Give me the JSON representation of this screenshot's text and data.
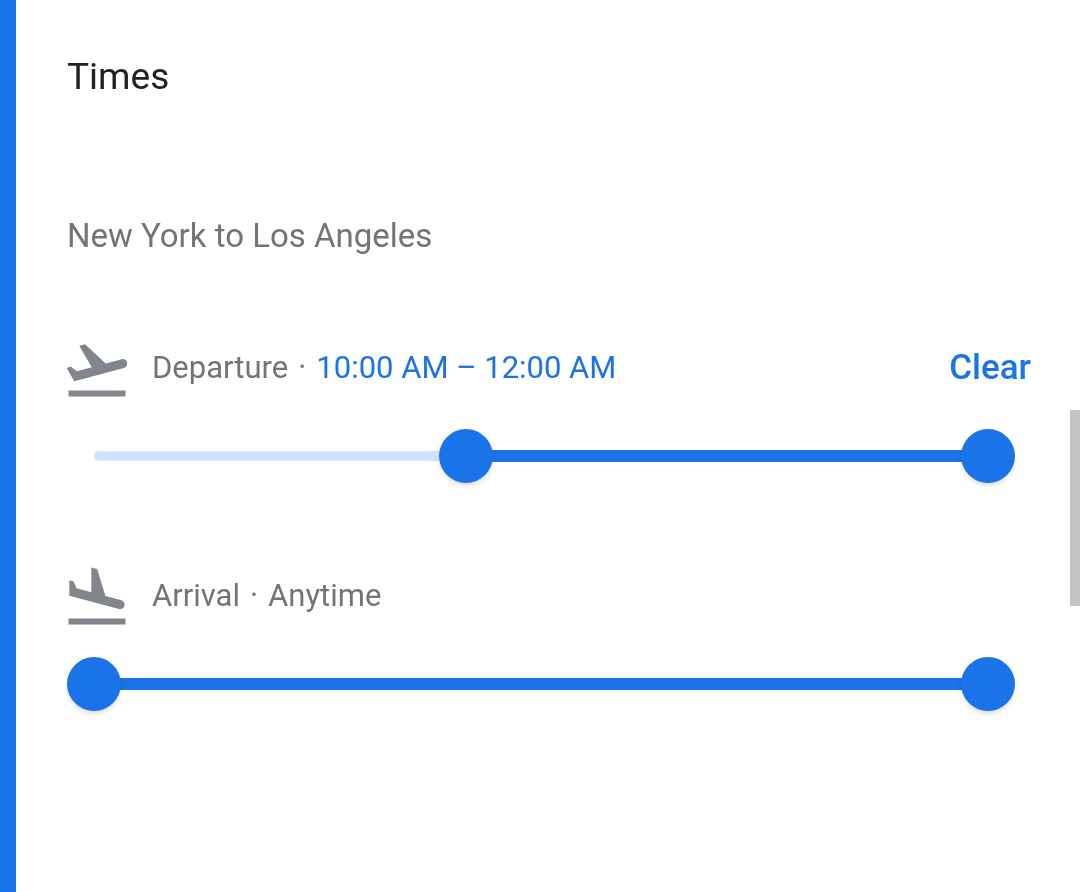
{
  "title": "Times",
  "route": "New York to Los Angeles",
  "filters": [
    {
      "kind": "departure",
      "label": "Departure",
      "separator": "·",
      "value": "10:00 AM – 12:00 AM",
      "value_highlighted": true,
      "action": "Clear",
      "start": {
        "level": 0.416
      },
      "end": {
        "level": 1
      }
    },
    {
      "kind": "arrival",
      "label": "Arrival",
      "separator": "·",
      "value": "Anytime",
      "value_highlighted": false,
      "start": {
        "level": 0
      },
      "end": {
        "level": 1
      }
    }
  ]
}
